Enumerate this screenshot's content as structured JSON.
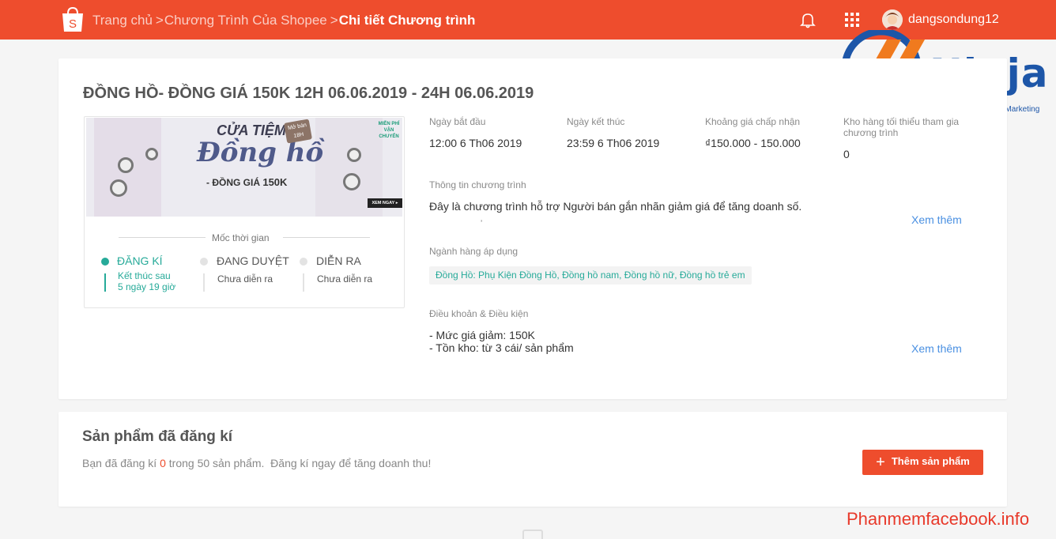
{
  "header": {
    "logo_icon": "shopee-bag-icon",
    "breadcrumb": [
      "Trang chủ",
      "Chương Trình Của Shopee",
      "Chi tiết Chương trình"
    ],
    "separator": ">",
    "username": "dangsondung12",
    "bg_color": "#ee4d2d"
  },
  "watermark": {
    "brand": "Ninja",
    "tagline": "Hệ thống phần mềm Marketing",
    "site": "Phanmemfacebook.info"
  },
  "program": {
    "title": "ĐỒNG HỒ- ĐỒNG GIÁ 150K 12H 06.06.2019 - 24H 06.06.2019",
    "banner": {
      "line1": "CỬA TIỆM",
      "line2": "Đồng hồ",
      "price_prefix": "- ĐỒNG GIÁ ",
      "price": "150K",
      "tag": "Mở bán\n18H",
      "free_ship": "MIỄN PHÍ VẬN CHUYỂN",
      "cta": "XEM NGAY ▸"
    },
    "timeline": {
      "heading": "Mốc thời gian",
      "steps": [
        {
          "name": "ĐĂNG KÍ",
          "sub": "Kết thúc sau\n5 ngày 19 giờ",
          "active": true
        },
        {
          "name": "ĐANG DUYỆT",
          "sub": "Chưa diễn ra",
          "active": false
        },
        {
          "name": "DIỄN RA",
          "sub": "Chưa diễn ra",
          "active": false
        }
      ]
    },
    "info": {
      "start_label": "Ngày bắt đầu",
      "start_value": "12:00 6 Th06 2019",
      "end_label": "Ngày kết thúc",
      "end_value": "23:59 6 Th06 2019",
      "price_label": "Khoảng giá chấp nhận",
      "price_value": "₫150.000 - 150.000",
      "stock_label": "Kho hàng tối thiểu tham gia chương trình",
      "stock_value": "0",
      "desc_label": "Thông tin chương trình",
      "desc_value": "Đây là chương trình hỗ trợ Người bán gắn nhãn giảm giá để tăng doanh số.",
      "category_label": "Ngành hàng áp dụng",
      "category_value": "Đồng Hồ: Phụ Kiện Đồng Hồ, Đồng hồ nam, Đồng hồ nữ, Đồng hồ trẻ em",
      "terms_label": "Điều khoản & Điều kiện",
      "terms_line1": "- Mức giá giảm: 150K",
      "terms_line2": "- Tồn kho: từ 3 cái/ sản phẩm",
      "see_more": "Xem thêm"
    },
    "colors": {
      "active": "#26aa99",
      "inactive": "#dddddd",
      "link": "#4a90e2"
    }
  },
  "registered": {
    "title": "Sản phẩm đã đăng kí",
    "desc_before": "Bạn đã đăng kí ",
    "count": "0",
    "desc_after": " trong 50 sản phẩm.  Đăng kí ngay để tăng doanh thu!",
    "add_button": "Thêm sản phẩm",
    "add_icon": "plus-icon"
  }
}
